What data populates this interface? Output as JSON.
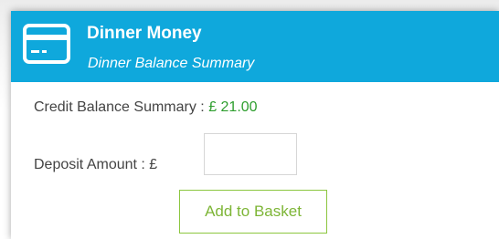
{
  "header": {
    "icon": "credit-card-icon",
    "title": "Dinner Money",
    "subtitle": "Dinner Balance Summary"
  },
  "credit": {
    "label": "Credit Balance Summary : ",
    "value": "£ 21.00"
  },
  "deposit": {
    "label": "Deposit Amount : £",
    "value": "",
    "placeholder": ""
  },
  "actions": {
    "add_label": "Add to Basket"
  },
  "colors": {
    "header_bg": "#0fa8dc",
    "credit_value": "#2e9e2e",
    "button_accent": "#8cc63f"
  }
}
